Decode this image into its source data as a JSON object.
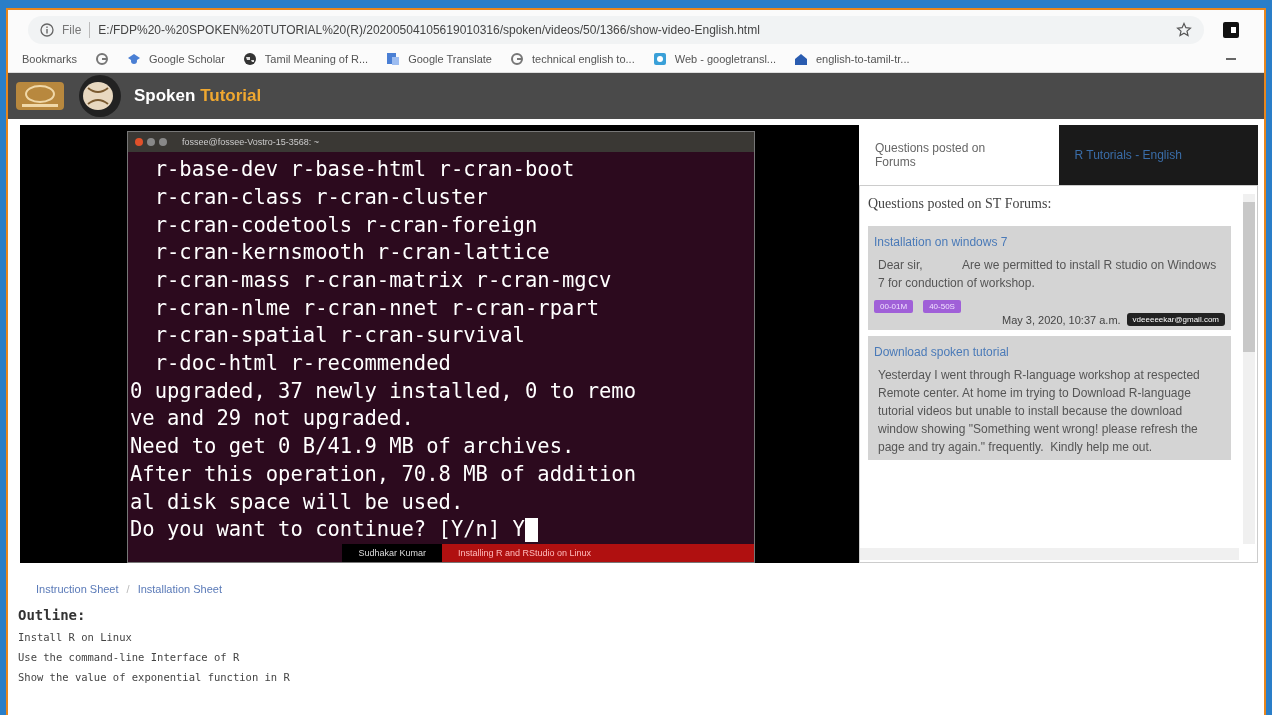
{
  "browser": {
    "scheme": "File",
    "url": "E:/FDP%20-%20SPOKEN%20TUTORIAL%20(R)/20200504105619010316/spoken/videos/50/1366/show-video-English.html"
  },
  "bookmarks": [
    {
      "label": "Bookmarks",
      "kind": "text"
    },
    {
      "kind": "g"
    },
    {
      "label": "Google Scholar",
      "kind": "scholar"
    },
    {
      "label": "Tamil Meaning of R...",
      "kind": "globe"
    },
    {
      "label": "Google Translate",
      "kind": "translate"
    },
    {
      "label": "technical english to...",
      "kind": "g"
    },
    {
      "label": "Web - googletransl...",
      "kind": "web"
    },
    {
      "label": "english-to-tamil-tr...",
      "kind": "home"
    }
  ],
  "site": {
    "name": "Spoken",
    "name_accent": "Tutorial"
  },
  "video": {
    "terminal_title": "fossee@fossee-Vostro-15-3568: ~",
    "lines": [
      "  r-base-dev r-base-html r-cran-boot",
      "  r-cran-class r-cran-cluster",
      "  r-cran-codetools r-cran-foreign",
      "  r-cran-kernsmooth r-cran-lattice",
      "  r-cran-mass r-cran-matrix r-cran-mgcv",
      "  r-cran-nlme r-cran-nnet r-cran-rpart",
      "  r-cran-spatial r-cran-survival",
      "  r-doc-html r-recommended",
      "0 upgraded, 37 newly installed, 0 to remo",
      "ve and 29 not upgraded.",
      "Need to get 0 B/41.9 MB of archives.",
      "After this operation, 70.8 MB of addition",
      "al disk space will be used.",
      "Do you want to continue? [Y/n] Y"
    ],
    "cursor": true,
    "author": "Sudhakar Kumar",
    "caption": "Installing R and RStudio on Linux"
  },
  "side_tabs": [
    {
      "label": "Questions posted on Forums",
      "selected": true
    },
    {
      "label": "R Tutorials - English",
      "selected": false
    }
  ],
  "forum": {
    "heading": "Questions posted on ST Forums:",
    "posts": [
      {
        "title": "Installation on windows 7",
        "body": "Dear sir,            Are we permitted to install R studio on Windows 7 for conduction of workshop.",
        "tags": [
          "00-01M",
          "40-50S"
        ],
        "date": "May 3, 2020, 10:37 a.m.",
        "user": "vdeeeeekar@gmail.com"
      },
      {
        "title": "Download spoken tutorial",
        "body": "Yesterday I went through R-language workshop at respected Remote center. At home im trying to Download R-language tutorial videos but unable to install because the download window showing \"Something went wrong! please refresh the page and try again.\" frequently.  Kindly help me out."
      }
    ]
  },
  "links": [
    "Instruction Sheet",
    "Installation Sheet"
  ],
  "link_separator": "/",
  "outline": {
    "heading": "Outline:",
    "items": [
      "Install R on Linux",
      "Use the command-line Interface of R",
      "Show the value of exponential function in R"
    ]
  }
}
